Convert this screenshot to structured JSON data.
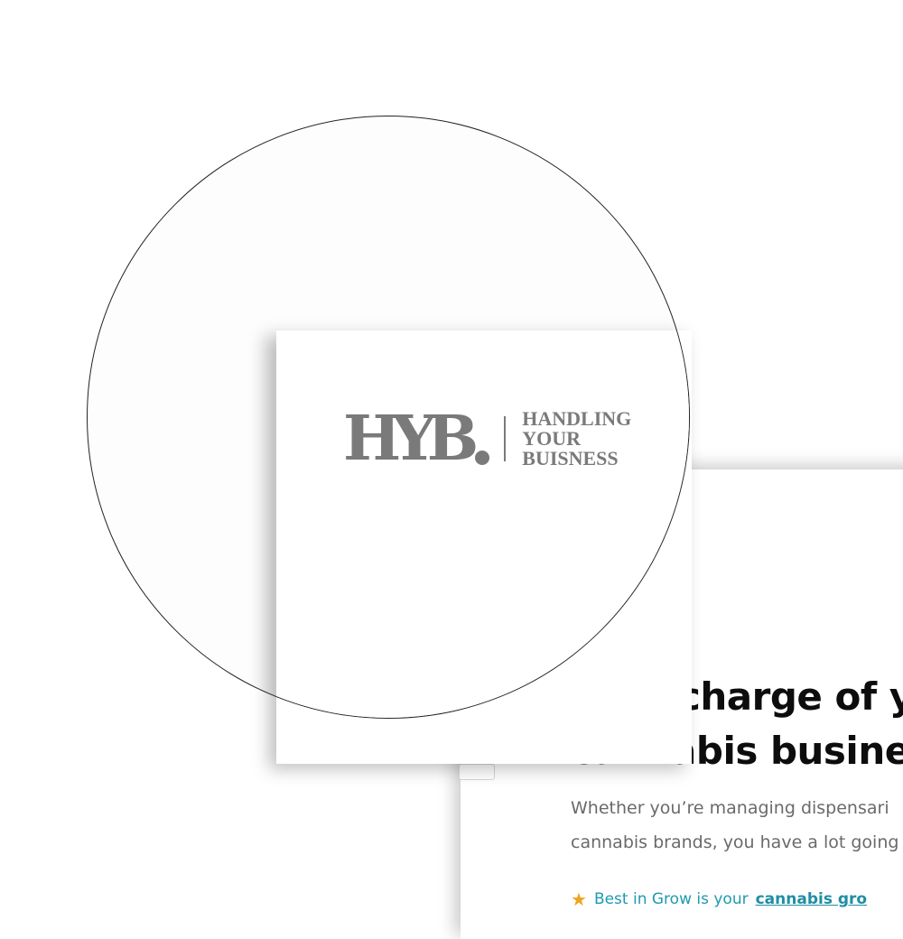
{
  "hero": {
    "title_line1": "Take charge of y",
    "title_line2": "cannabis busine",
    "subtitle_line1": "Whether you’re managing dispensari",
    "subtitle_line2": "cannabis brands, you have a lot going",
    "promo_text": "Best in Grow is your",
    "promo_link": "cannabis gro"
  },
  "brand": {
    "mark": "HYB",
    "tagline_line1": "HANDLING",
    "tagline_line2": "YOUR",
    "tagline_line3": "BUISNESS"
  },
  "colors": {
    "logo_gray": "#7a7a7a",
    "accent_teal": "#1f9ab0",
    "blob_peach": "#fbe3c4",
    "star_orange": "#f0a41f"
  },
  "icons": {
    "promo": "star-icon"
  }
}
